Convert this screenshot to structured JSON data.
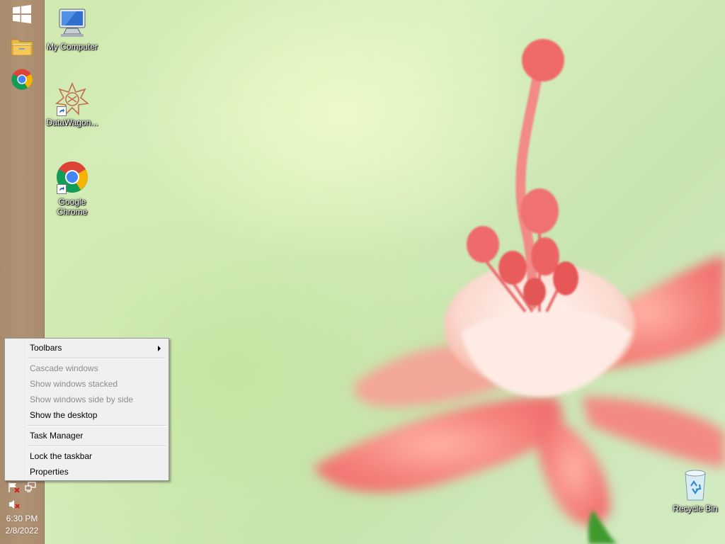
{
  "desktop": {
    "icons": [
      {
        "label": "My Computer",
        "icon": "computer-icon"
      },
      {
        "label": "DataWagon...",
        "icon": "datawagon-icon"
      },
      {
        "label": "Google Chrome",
        "label_line1": "Google",
        "label_line2": "Chrome",
        "icon": "chrome-icon"
      },
      {
        "label": "Recycle Bin",
        "icon": "recycle-bin-icon"
      }
    ]
  },
  "taskbar": {
    "pinned": [
      {
        "name": "start",
        "icon": "windows-logo-icon"
      },
      {
        "name": "file-explorer",
        "icon": "folder-icon"
      },
      {
        "name": "chrome",
        "icon": "chrome-icon"
      }
    ],
    "tray_icons": [
      "action-center-flag-icon",
      "network-icon",
      "volume-muted-icon"
    ],
    "clock": {
      "time": "6:30 PM",
      "date": "2/8/2022"
    }
  },
  "context_menu": {
    "items": [
      {
        "label": "Toolbars",
        "enabled": true,
        "submenu": true
      },
      {
        "label": "Cascade windows",
        "enabled": false
      },
      {
        "label": "Show windows stacked",
        "enabled": false
      },
      {
        "label": "Show windows side by side",
        "enabled": false
      },
      {
        "label": "Show the desktop",
        "enabled": true
      },
      {
        "label": "Task Manager",
        "enabled": true
      },
      {
        "label": "Lock the taskbar",
        "enabled": true
      },
      {
        "label": "Properties",
        "enabled": true
      }
    ]
  },
  "colors": {
    "taskbar": "#a88a6c",
    "menu_bg": "#f0f0f0",
    "disabled_text": "#8d8d8d",
    "wallpaper_green": "#d9f0bf",
    "petal_pink": "#f27a7a"
  }
}
